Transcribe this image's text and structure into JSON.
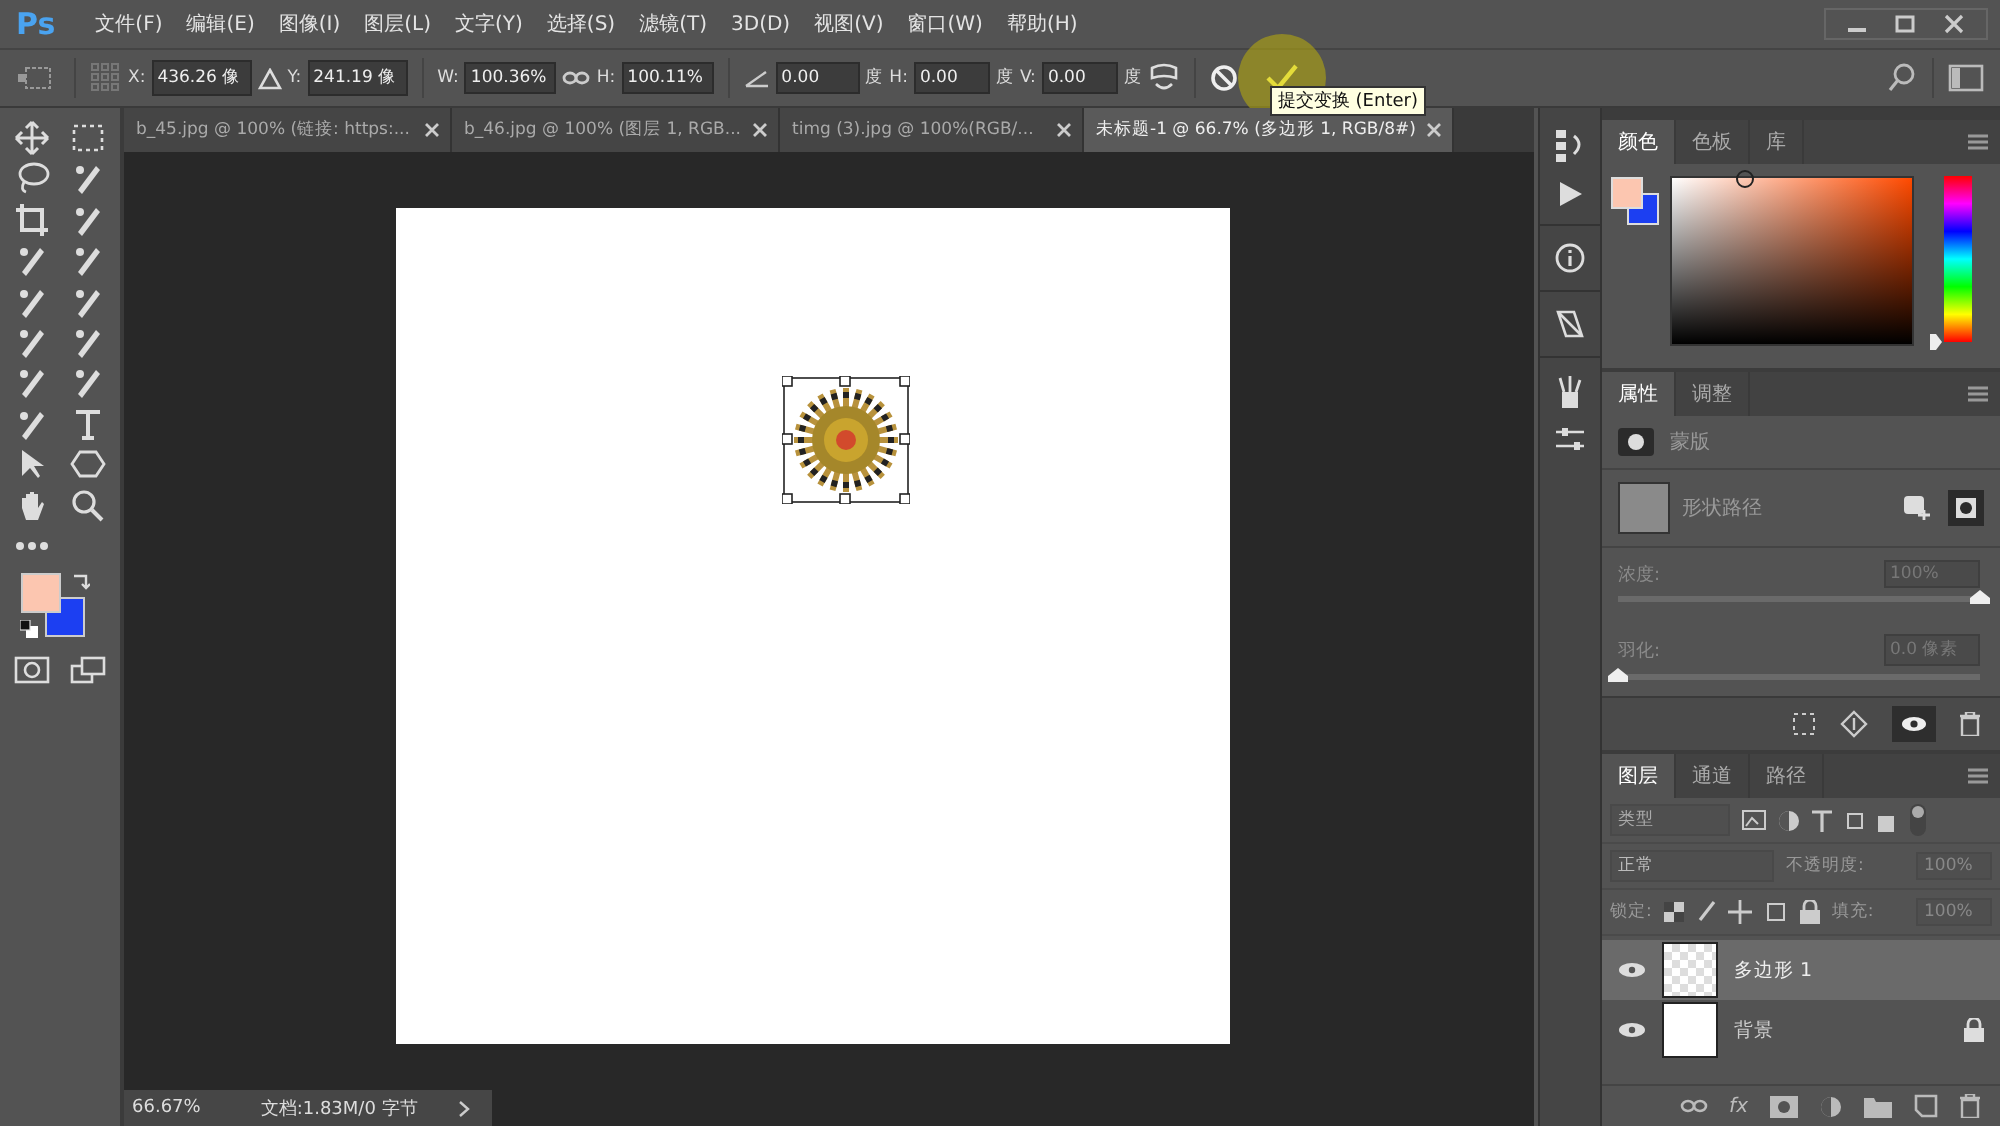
{
  "app": {
    "logo": "Ps"
  },
  "menu": [
    "文件(F)",
    "编辑(E)",
    "图像(I)",
    "图层(L)",
    "文字(Y)",
    "选择(S)",
    "滤镜(T)",
    "3D(D)",
    "视图(V)",
    "窗口(W)",
    "帮助(H)"
  ],
  "options": {
    "x": {
      "label": "X:",
      "value": "436.26 像"
    },
    "y": {
      "label": "Y:",
      "value": "241.19 像"
    },
    "w": {
      "label": "W:",
      "value": "100.36%"
    },
    "h": {
      "label": "H:",
      "value": "100.11%"
    },
    "rotate": {
      "value": "0.00",
      "unit": "度"
    },
    "skew_h": {
      "label": "H:",
      "value": "0.00",
      "unit": "度"
    },
    "skew_v": {
      "label": "V:",
      "value": "0.00",
      "unit": "度"
    }
  },
  "tooltip": "提交变换 (Enter)",
  "tabs": [
    {
      "label": "b_45.jpg @ 100% (链接: https:...",
      "selected": false
    },
    {
      "label": "b_46.jpg @ 100% (图层 1, RGB...",
      "selected": false
    },
    {
      "label": "timg (3).jpg @ 100%(RGB/...",
      "selected": false
    },
    {
      "label": "未标题-1 @ 66.7% (多边形 1, RGB/8#)",
      "selected": true
    }
  ],
  "color_panel": {
    "tabs": [
      {
        "label": "颜色",
        "selected": true
      },
      {
        "label": "色板",
        "selected": false
      },
      {
        "label": "库",
        "selected": false
      }
    ]
  },
  "properties_panel": {
    "tabs": [
      {
        "label": "属性",
        "selected": true
      },
      {
        "label": "调整",
        "selected": false
      }
    ],
    "section": "蒙版",
    "mask_label": "形状路径",
    "sliders": [
      {
        "label": "浓度:",
        "value": "100%",
        "level": 1,
        "disabled": true
      },
      {
        "label": "羽化:",
        "value": "0.0 像素",
        "level": 0,
        "disabled": true
      }
    ]
  },
  "layers_panel": {
    "tabs": [
      {
        "label": "图层",
        "selected": true
      },
      {
        "label": "通道",
        "selected": false
      },
      {
        "label": "路径",
        "selected": false
      }
    ],
    "filter": "类型",
    "blend_mode": "正常",
    "opacity_label": "不透明度:",
    "opacity": "100%",
    "lock_label": "锁定:",
    "fill_label": "填充:",
    "fill": "100%",
    "layers": [
      {
        "name": "多边形 1",
        "selected": true,
        "visible": true,
        "locked": false,
        "kind": "shape"
      },
      {
        "name": "背景",
        "selected": false,
        "visible": true,
        "locked": true,
        "kind": "background"
      }
    ],
    "style_button": "fx"
  },
  "status_bar": {
    "zoom": "66.67%",
    "doc_info": "文档:1.83M/0 字节"
  }
}
